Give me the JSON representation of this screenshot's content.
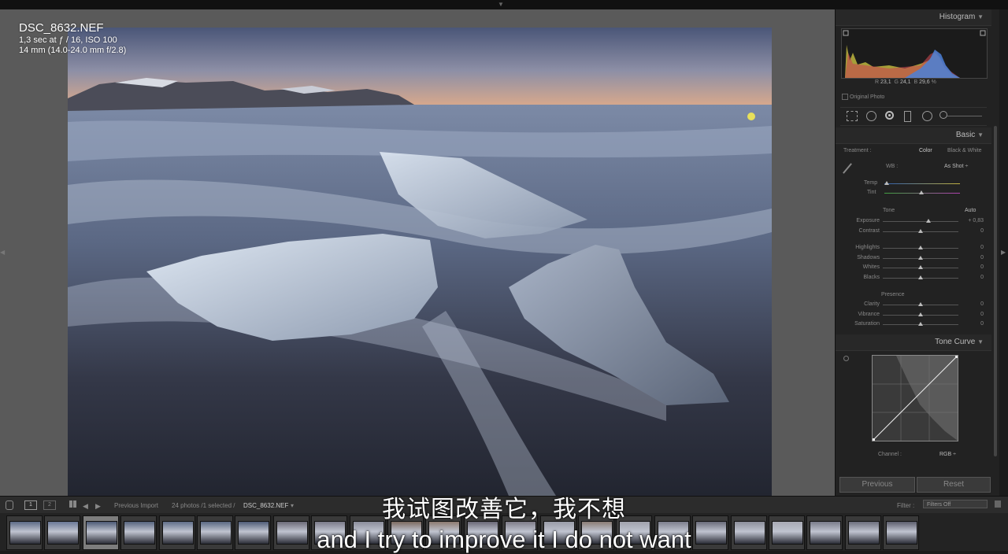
{
  "photo": {
    "filename": "DSC_8632.NEF",
    "exposure_line": "1,3 sec at ƒ / 16, ISO 100",
    "lens_line": "14 mm (14.0-24.0 mm f/2.8)"
  },
  "histogram": {
    "title": "Histogram",
    "r_label": "R",
    "r_value": "23,1",
    "g_label": "G",
    "g_value": "24,1",
    "b_label": "B",
    "b_value": "29,6",
    "pct": "%",
    "original_photo": "Original Photo"
  },
  "basic": {
    "title": "Basic",
    "treatment_label": "Treatment :",
    "color": "Color",
    "bw": "Black & White",
    "wb_label": "WB :",
    "wb_value": "As Shot ÷",
    "temp": "Temp",
    "tint": "Tint",
    "tone_label": "Tone",
    "auto": "Auto",
    "sliders": [
      {
        "label": "Exposure",
        "value": "+ 0,83",
        "level": 0.6
      },
      {
        "label": "Contrast",
        "value": "0",
        "level": 0.5
      },
      {
        "label": "Highlights",
        "value": "0",
        "level": 0.5
      },
      {
        "label": "Shadows",
        "value": "0",
        "level": 0.5
      },
      {
        "label": "Whites",
        "value": "0",
        "level": 0.5
      },
      {
        "label": "Blacks",
        "value": "0",
        "level": 0.5
      }
    ],
    "presence_label": "Presence",
    "presence": [
      {
        "label": "Clarity",
        "value": "0",
        "level": 0.5
      },
      {
        "label": "Vibrance",
        "value": "0",
        "level": 0.5
      },
      {
        "label": "Saturation",
        "value": "0",
        "level": 0.5
      }
    ]
  },
  "tone_curve": {
    "title": "Tone Curve",
    "channel_label": "Channel :",
    "channel_value": "RGB ÷"
  },
  "buttons": {
    "previous": "Previous",
    "reset": "Reset"
  },
  "filmstrip": {
    "view1": "1",
    "view2": "2",
    "source": "Previous Import",
    "count": "24 photos /1 selected /",
    "current": "DSC_8632.NEF",
    "filter_label": "Filter :",
    "filter_value": "Filters Off"
  },
  "subtitles": {
    "chinese": "我试图改善它，我不想",
    "english": "and I try to improve it I do not want"
  },
  "colors": {
    "panel_bg": "#222222",
    "canvas_bg": "#5a5a5a",
    "selected_thumb": "#7d7d7d"
  }
}
